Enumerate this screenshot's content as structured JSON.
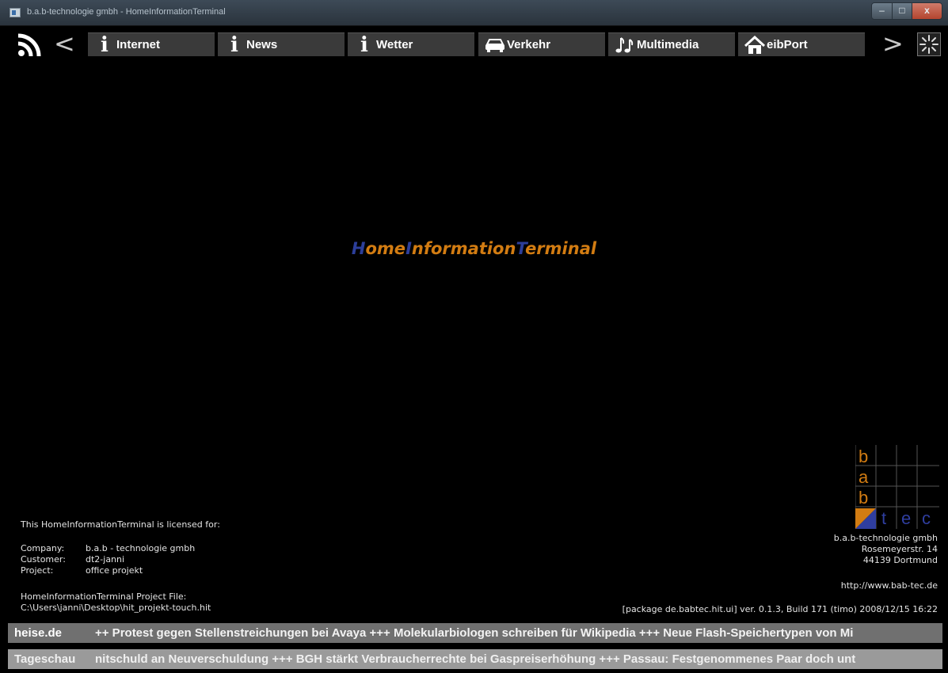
{
  "window": {
    "title": "b.a.b-technologie gmbh - HomeInformationTerminal",
    "minimize_glyph": "–",
    "maximize_glyph": "□",
    "close_glyph": "x"
  },
  "navbar": {
    "left_arrow": "<",
    "right_arrow": ">",
    "rss_icon": "rss-icon",
    "loader_icon": "loading-spinner-icon",
    "buttons": [
      {
        "label": "Internet",
        "icon": "info-icon"
      },
      {
        "label": "News",
        "icon": "info-icon"
      },
      {
        "label": "Wetter",
        "icon": "info-icon"
      },
      {
        "label": "Verkehr",
        "icon": "car-icon"
      },
      {
        "label": "Multimedia",
        "icon": "music-note-icon"
      },
      {
        "label": "eibPort",
        "icon": "home-icon"
      }
    ]
  },
  "center_title": {
    "parts": [
      "H",
      "ome",
      "I",
      "nformation",
      "T",
      "erminal"
    ]
  },
  "colors": {
    "title_blue": "#2c3e9a",
    "title_orange": "#d27c12",
    "logo_orange": "#d27c12",
    "logo_blue": "#2f3ea0"
  },
  "logo": {
    "letters_left": [
      "b",
      "a",
      "b"
    ],
    "letters_bottom": [
      "t",
      "e",
      "c"
    ]
  },
  "license": {
    "heading": "This HomeInformationTerminal is licensed for:",
    "rows": [
      {
        "key": "Company:",
        "value": "b.a.b - technologie gmbh"
      },
      {
        "key": "Customer:",
        "value": "dt2-janni"
      },
      {
        "key": "Project:",
        "value": "office projekt"
      }
    ],
    "project_file_label": "HomeInformationTerminal Project File:",
    "project_file_path": "C:\\Users\\janni\\Desktop\\hit_projekt-touch.hit"
  },
  "company": {
    "name": "b.a.b-technologie gmbh",
    "street": "Rosemeyerstr. 14",
    "city": "44139 Dortmund",
    "url": "http://www.bab-tec.de",
    "version": "[package de.babtec.hit.ui] ver. 0.1.3, Build 171 (timo) 2008/12/15 16:22"
  },
  "tickers": [
    {
      "source": "heise.de",
      "text": "++  Protest gegen Stellenstreichungen bei Avaya  +++  Molekularbiologen schreiben für Wikipedia  +++  Neue Flash-Speichertypen von Mi"
    },
    {
      "source": "Tageschau",
      "text": "nitschuld an Neuverschuldung  +++  BGH stärkt Verbraucherrechte bei Gaspreiserhöhung  +++  Passau: Festgenommenes Paar doch unt"
    }
  ]
}
